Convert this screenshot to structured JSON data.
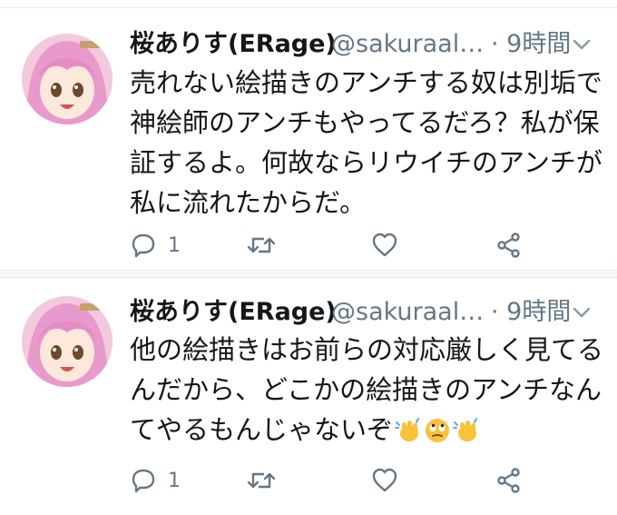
{
  "tweets": [
    {
      "name": "桜ありす(ERage)",
      "handle": "@sakuraal…",
      "time": "· 9時間",
      "lines": [
        "売れない絵描きのアンチする奴は別垢で",
        "神絵師のアンチもやってるだろ？私が保",
        "証するよ。何故ならリウイチのアンチが",
        "私に流れたからだ。"
      ],
      "reply_count": "1"
    },
    {
      "name": "桜ありす(ERage)",
      "handle": "@sakuraal…",
      "time": "· 9時間",
      "lines": [
        "他の絵描きはお前らの対応厳しく見てる",
        "んだから、どこかの絵描きのアンチなん",
        "てやるもんじゃないぞ"
      ],
      "emojis": [
        "waving-hands-emoji",
        "eye-roll-emoji",
        "waving-hands-emoji"
      ],
      "reply_count": "1"
    }
  ],
  "colors": {
    "text": "#14171a",
    "secondary": "#657786",
    "divider": "#e6ecf0"
  },
  "icons": [
    "reply-icon",
    "retweet-icon",
    "like-icon",
    "share-icon",
    "caret-down-icon"
  ]
}
